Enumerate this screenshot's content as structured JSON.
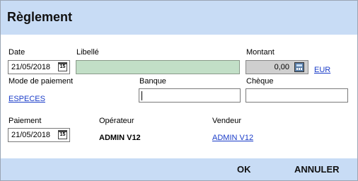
{
  "window": {
    "title": "Règlement"
  },
  "form": {
    "date": {
      "label": "Date",
      "value": "21/05/2018"
    },
    "libelle": {
      "label": "Libellé",
      "value": ""
    },
    "montant": {
      "label": "Montant",
      "value": "0,00",
      "currency": "EUR"
    },
    "mode_paiement": {
      "label": "Mode de paiement",
      "value": "ESPECES"
    },
    "banque": {
      "label": "Banque",
      "value": ""
    },
    "cheque": {
      "label": "Chèque",
      "value": ""
    },
    "paiement": {
      "label": "Paiement",
      "value": "21/05/2018"
    },
    "operateur": {
      "label": "Opérateur",
      "value": "ADMIN V12"
    },
    "vendeur": {
      "label": "Vendeur",
      "value": "ADMIN V12"
    }
  },
  "calendar_icon_glyph": "15",
  "footer": {
    "ok_label": "OK",
    "cancel_label": "ANNULER"
  },
  "colors": {
    "title_bar": "#c8dcf5",
    "libelle_field": "#c2dfc7",
    "link": "#1a3cc8"
  }
}
